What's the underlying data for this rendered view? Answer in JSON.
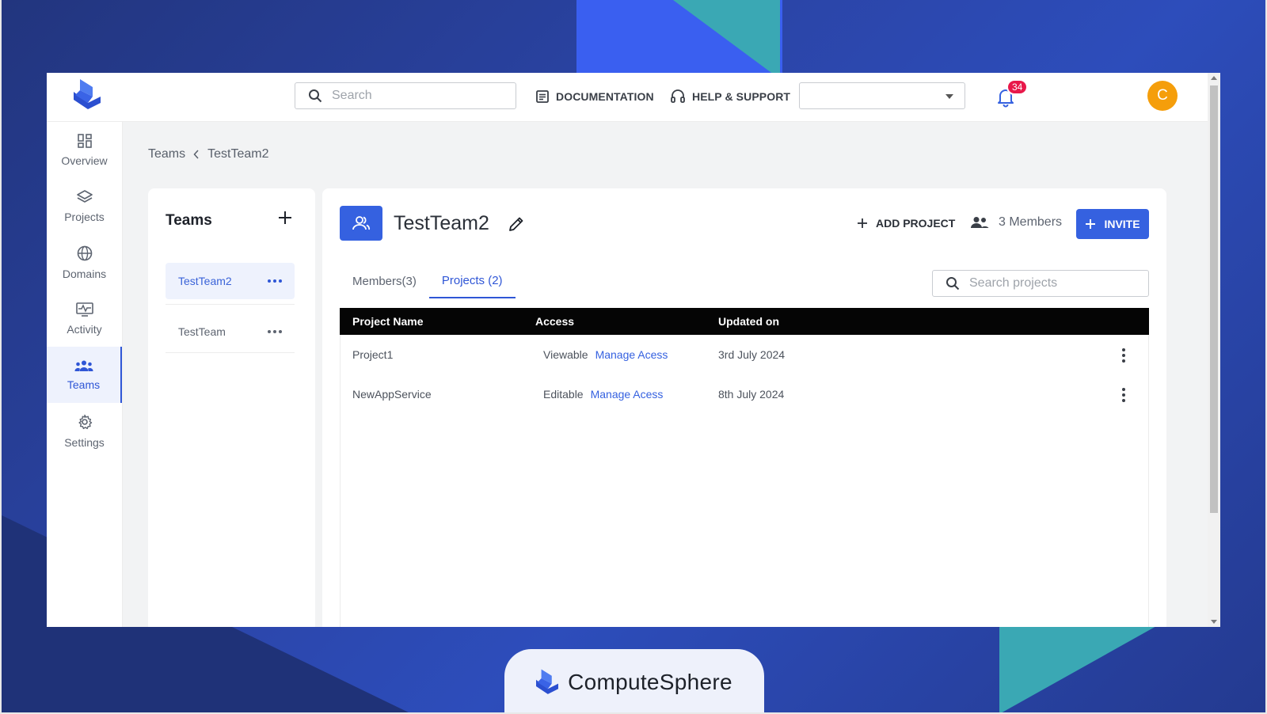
{
  "topbar": {
    "search_placeholder": "Search",
    "documentation_label": "DOCUMENTATION",
    "help_label": "HELP & SUPPORT",
    "notification_count": "34",
    "avatar_initial": "C"
  },
  "sidebar": {
    "items": [
      {
        "label": "Overview",
        "icon": "dashboard-icon"
      },
      {
        "label": "Projects",
        "icon": "layers-icon"
      },
      {
        "label": "Domains",
        "icon": "globe-icon"
      },
      {
        "label": "Activity",
        "icon": "activity-icon"
      },
      {
        "label": "Teams",
        "icon": "team-icon",
        "active": true
      },
      {
        "label": "Settings",
        "icon": "gear-icon"
      }
    ]
  },
  "breadcrumb": {
    "parent": "Teams",
    "current": "TestTeam2"
  },
  "teams_panel": {
    "title": "Teams",
    "teams": [
      {
        "name": "TestTeam2",
        "selected": true
      },
      {
        "name": "TestTeam",
        "selected": false
      }
    ]
  },
  "team_detail": {
    "name": "TestTeam2",
    "add_project_label": "ADD PROJECT",
    "members_label": "3 Members",
    "invite_label": "INVITE",
    "tabs": [
      {
        "label": "Members(3)",
        "active": false
      },
      {
        "label": "Projects (2)",
        "active": true
      }
    ],
    "search_placeholder": "Search projects",
    "table": {
      "columns": [
        "Project Name",
        "Access",
        "Updated on"
      ],
      "rows": [
        {
          "name": "Project1",
          "access": "Viewable",
          "action": "Manage Acess",
          "updated": "3rd July 2024"
        },
        {
          "name": "NewAppService",
          "access": "Editable",
          "action": "Manage Acess",
          "updated": "8th July 2024"
        }
      ]
    }
  },
  "brand": {
    "name": "ComputeSphere"
  },
  "colors": {
    "accent": "#3561e0",
    "badge": "#e8184a",
    "avatar": "#f59e0b",
    "table_header": "#050505"
  }
}
